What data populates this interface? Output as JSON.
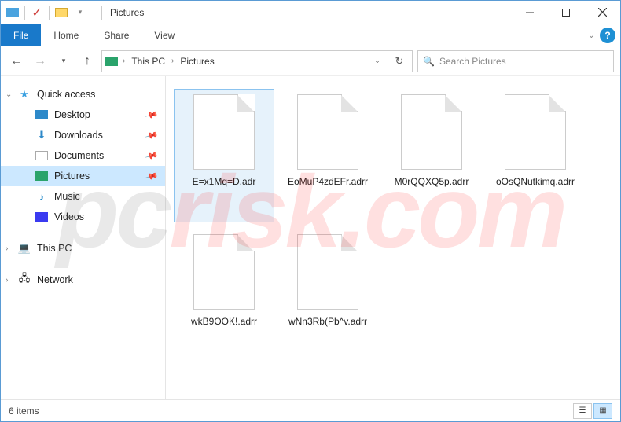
{
  "window": {
    "title": "Pictures"
  },
  "ribbon": {
    "file_label": "File",
    "tabs": [
      "Home",
      "Share",
      "View"
    ]
  },
  "breadcrumbs": [
    "This PC",
    "Pictures"
  ],
  "search": {
    "placeholder": "Search Pictures"
  },
  "sidebar": {
    "quick_access": "Quick access",
    "items": [
      {
        "label": "Desktop",
        "icon": "desktop"
      },
      {
        "label": "Downloads",
        "icon": "dl"
      },
      {
        "label": "Documents",
        "icon": "doc"
      },
      {
        "label": "Pictures",
        "icon": "pic",
        "selected": true
      },
      {
        "label": "Music",
        "icon": "note"
      },
      {
        "label": "Videos",
        "icon": "vid"
      }
    ],
    "this_pc": "This PC",
    "network": "Network"
  },
  "files": [
    {
      "name": "E=x1Mq=D.adr",
      "selected": true
    },
    {
      "name": "EoMuP4zdEFr.adrr"
    },
    {
      "name": "M0rQQXQ5p.adrr"
    },
    {
      "name": "oOsQNutkimq.adrr"
    },
    {
      "name": "wkB9OOK!.adrr"
    },
    {
      "name": "wNn3Rb(Pb^v.adrr"
    }
  ],
  "status": {
    "text": "6 items"
  },
  "watermark": {
    "prefix": "pc",
    "suffix": "risk.com"
  }
}
